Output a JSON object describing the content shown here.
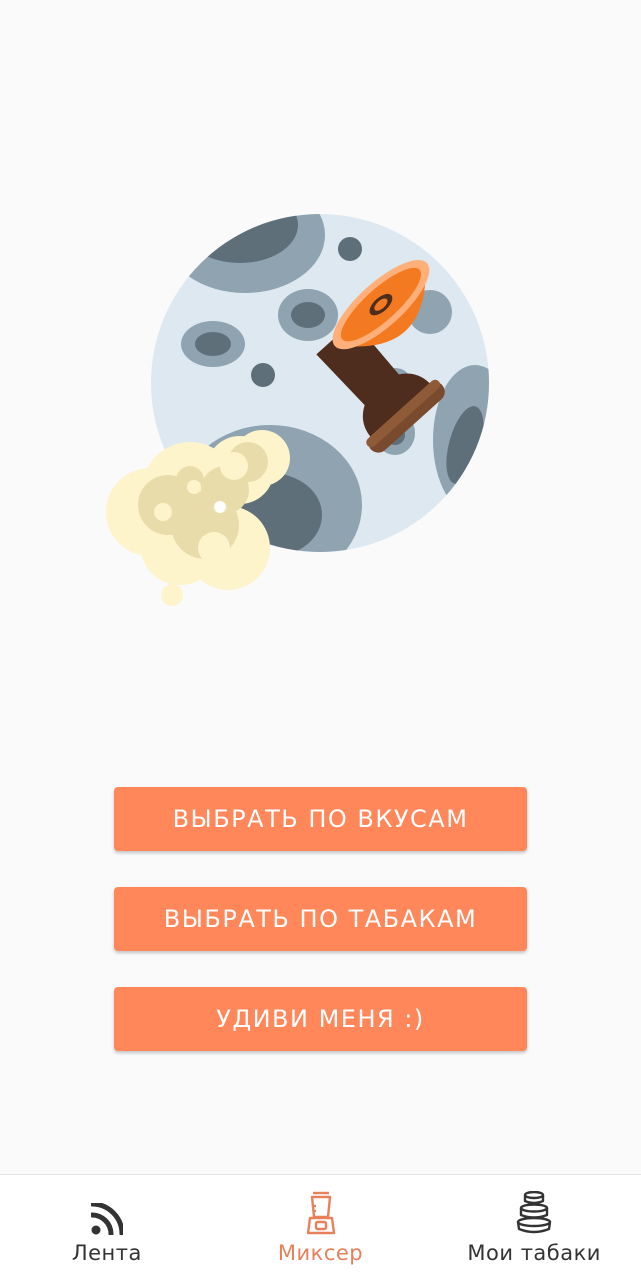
{
  "colors": {
    "accent": "#ff875a",
    "nav_active": "#e8805c",
    "nav_inactive": "#333333",
    "background": "#fafafa"
  },
  "hero": {
    "icon": "hookah-bowl-moon-illustration"
  },
  "actions": [
    {
      "label": "ВЫБРАТЬ ПО ВКУСАМ"
    },
    {
      "label": "ВЫБРАТЬ ПО ТАБАКАМ"
    },
    {
      "label": "УДИВИ МЕНЯ :)"
    }
  ],
  "bottom_nav": {
    "active_index": 1,
    "items": [
      {
        "label": "Лента",
        "icon": "rss-feed-icon"
      },
      {
        "label": "Миксер",
        "icon": "blender-icon"
      },
      {
        "label": "Мои табаки",
        "icon": "stacked-jars-icon"
      }
    ]
  }
}
